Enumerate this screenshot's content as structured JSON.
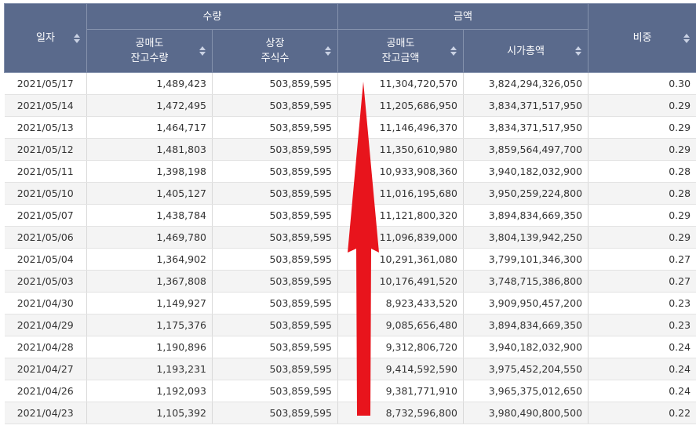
{
  "header": {
    "date": "일자",
    "quantity_group": "수량",
    "amount_group": "금액",
    "ratio": "비중",
    "short_balance_qty": [
      "공매도",
      "잔고수량"
    ],
    "listed_shares": [
      "상장",
      "주식수"
    ],
    "short_balance_amt": [
      "공매도",
      "잔고금액"
    ],
    "market_cap": "시가총액"
  },
  "rows": [
    {
      "date": "2021/05/17",
      "short_qty": "1,489,423",
      "listed": "503,859,595",
      "short_amt": "11,304,720,570",
      "market_cap": "3,824,294,326,050",
      "ratio": "0.30"
    },
    {
      "date": "2021/05/14",
      "short_qty": "1,472,495",
      "listed": "503,859,595",
      "short_amt": "11,205,686,950",
      "market_cap": "3,834,371,517,950",
      "ratio": "0.29"
    },
    {
      "date": "2021/05/13",
      "short_qty": "1,464,717",
      "listed": "503,859,595",
      "short_amt": "11,146,496,370",
      "market_cap": "3,834,371,517,950",
      "ratio": "0.29"
    },
    {
      "date": "2021/05/12",
      "short_qty": "1,481,803",
      "listed": "503,859,595",
      "short_amt": "11,350,610,980",
      "market_cap": "3,859,564,497,700",
      "ratio": "0.29"
    },
    {
      "date": "2021/05/11",
      "short_qty": "1,398,198",
      "listed": "503,859,595",
      "short_amt": "10,933,908,360",
      "market_cap": "3,940,182,032,900",
      "ratio": "0.28"
    },
    {
      "date": "2021/05/10",
      "short_qty": "1,405,127",
      "listed": "503,859,595",
      "short_amt": "11,016,195,680",
      "market_cap": "3,950,259,224,800",
      "ratio": "0.28"
    },
    {
      "date": "2021/05/07",
      "short_qty": "1,438,784",
      "listed": "503,859,595",
      "short_amt": "11,121,800,320",
      "market_cap": "3,894,834,669,350",
      "ratio": "0.29"
    },
    {
      "date": "2021/05/06",
      "short_qty": "1,469,780",
      "listed": "503,859,595",
      "short_amt": "11,096,839,000",
      "market_cap": "3,804,139,942,250",
      "ratio": "0.29"
    },
    {
      "date": "2021/05/04",
      "short_qty": "1,364,902",
      "listed": "503,859,595",
      "short_amt": "10,291,361,080",
      "market_cap": "3,799,101,346,300",
      "ratio": "0.27"
    },
    {
      "date": "2021/05/03",
      "short_qty": "1,367,808",
      "listed": "503,859,595",
      "short_amt": "10,176,491,520",
      "market_cap": "3,748,715,386,800",
      "ratio": "0.27"
    },
    {
      "date": "2021/04/30",
      "short_qty": "1,149,927",
      "listed": "503,859,595",
      "short_amt": "8,923,433,520",
      "market_cap": "3,909,950,457,200",
      "ratio": "0.23"
    },
    {
      "date": "2021/04/29",
      "short_qty": "1,175,376",
      "listed": "503,859,595",
      "short_amt": "9,085,656,480",
      "market_cap": "3,894,834,669,350",
      "ratio": "0.23"
    },
    {
      "date": "2021/04/28",
      "short_qty": "1,190,896",
      "listed": "503,859,595",
      "short_amt": "9,312,806,720",
      "market_cap": "3,940,182,032,900",
      "ratio": "0.24"
    },
    {
      "date": "2021/04/27",
      "short_qty": "1,193,231",
      "listed": "503,859,595",
      "short_amt": "9,414,592,590",
      "market_cap": "3,975,452,204,550",
      "ratio": "0.24"
    },
    {
      "date": "2021/04/26",
      "short_qty": "1,192,093",
      "listed": "503,859,595",
      "short_amt": "9,381,771,910",
      "market_cap": "3,965,375,012,650",
      "ratio": "0.24"
    },
    {
      "date": "2021/04/23",
      "short_qty": "1,105,392",
      "listed": "503,859,595",
      "short_amt": "8,732,596,800",
      "market_cap": "3,980,490,800,500",
      "ratio": "0.22"
    }
  ],
  "colors": {
    "header_bg": "#5a6a8c",
    "header_text": "#ffffff",
    "stripe_bg": "#f4f4f4",
    "annotation_arrow": "#e8141c"
  },
  "icons": {
    "sort": "sort-updown-icon",
    "annotation": "red-up-arrow-icon"
  }
}
